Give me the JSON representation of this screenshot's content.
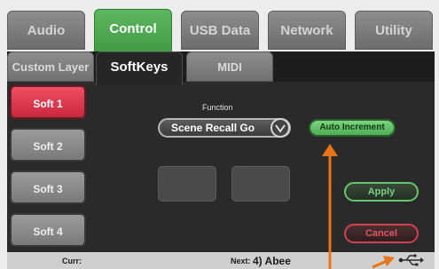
{
  "top_tabs": [
    {
      "label": "Audio"
    },
    {
      "label": "Control"
    },
    {
      "label": "USB Data"
    },
    {
      "label": "Network"
    },
    {
      "label": "Utility"
    }
  ],
  "sub_tabs": [
    {
      "label": "Custom Layer"
    },
    {
      "label": "SoftKeys"
    },
    {
      "label": "MIDI"
    }
  ],
  "soft_keys": [
    {
      "label": "Soft 1"
    },
    {
      "label": "Soft 2"
    },
    {
      "label": "Soft 3"
    },
    {
      "label": "Soft 4"
    }
  ],
  "function": {
    "label": "Function",
    "value": "Scene Recall Go",
    "auto_increment_label": "Auto Increment"
  },
  "actions": {
    "apply_label": "Apply",
    "cancel_label": "Cancel"
  },
  "status": {
    "curr_label": "Curr:",
    "next_label": "Next:",
    "next_scene": "4) Abee"
  },
  "colors": {
    "active_tab": "#4caf50",
    "active_softkey": "#e8384f",
    "auto_increment": "#5fc064",
    "apply_border": "#68c46d",
    "cancel_border": "#d2414f",
    "annotation_arrow": "#e8751a"
  },
  "icons": {
    "chevron": "chevron-down-icon",
    "usb": "usb-icon"
  }
}
